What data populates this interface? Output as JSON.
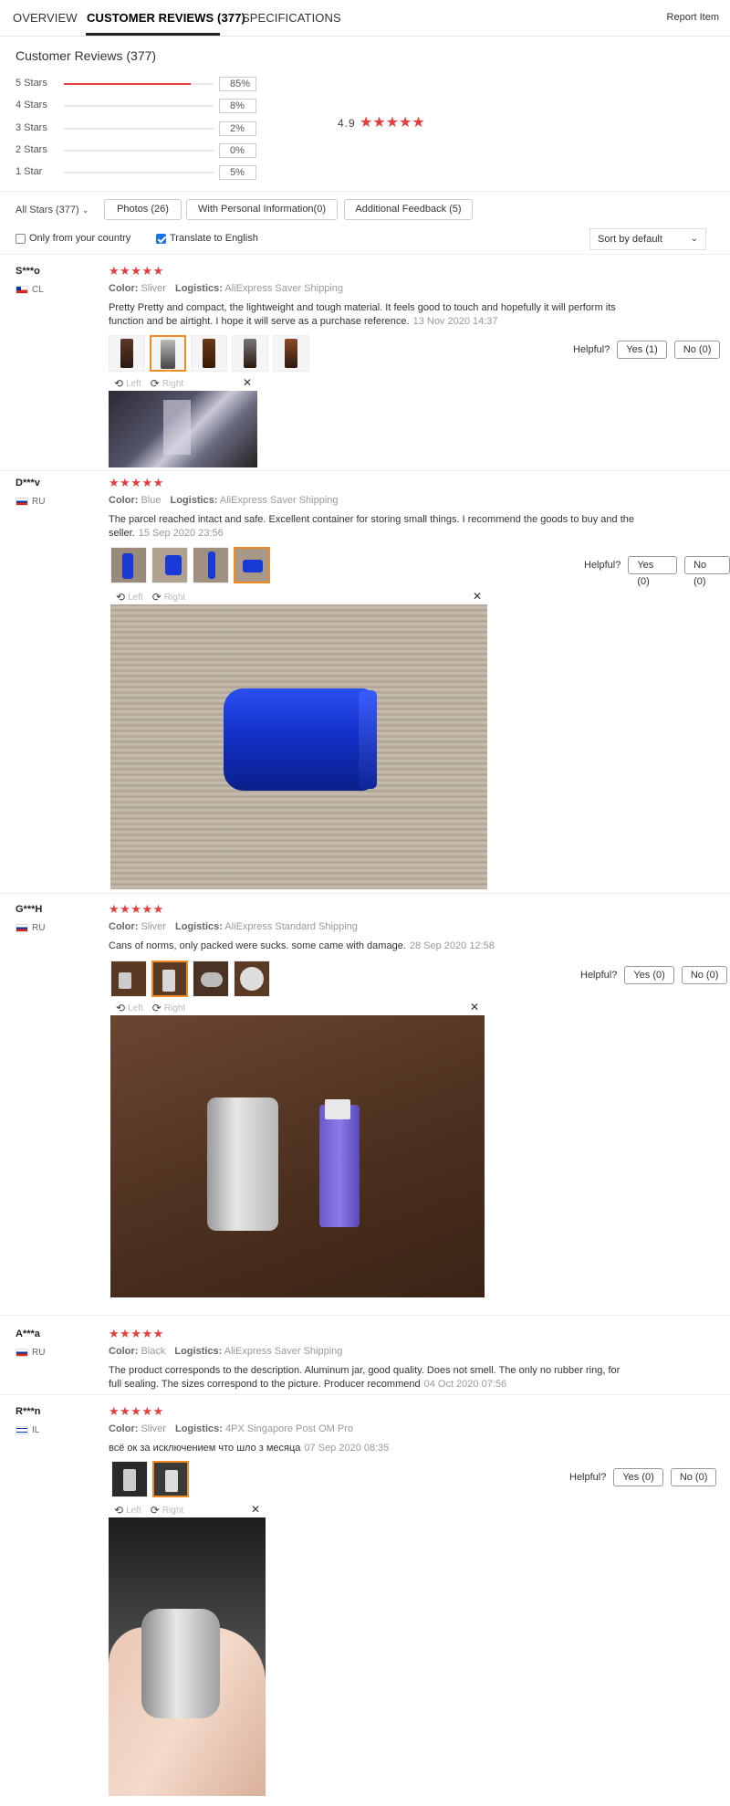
{
  "tabs": {
    "overview": "OVERVIEW",
    "reviews": "CUSTOMER REVIEWS (377)",
    "specs": "SPECIFICATIONS",
    "report": "Report Item"
  },
  "summary": {
    "title": "Customer Reviews (377)",
    "distribution": [
      {
        "label": "5 Stars",
        "pct": "85%",
        "fraction": 0.85
      },
      {
        "label": "4 Stars",
        "pct": "8%",
        "fraction": 0.08
      },
      {
        "label": "3 Stars",
        "pct": "2%",
        "fraction": 0.02
      },
      {
        "label": "2 Stars",
        "pct": "0%",
        "fraction": 0.0
      },
      {
        "label": "1 Star",
        "pct": "5%",
        "fraction": 0.05
      }
    ],
    "average": "4.9",
    "average_stars": "★★★★★"
  },
  "filters": {
    "all_stars": "All Stars (377)",
    "photos": "Photos (26)",
    "personal": "With Personal Information(0)",
    "additional": "Additional Feedback (5)",
    "only_country": "Only from your country",
    "translate": "Translate to English",
    "sort": "Sort by default"
  },
  "viewer": {
    "left": "Left",
    "right": "Right"
  },
  "helpful_label": "Helpful?",
  "reviews": [
    {
      "user": "S***o",
      "country": "CL",
      "stars": "★★★★★",
      "color_label": "Color:",
      "color": "Sliver",
      "logistics_label": "Logistics:",
      "logistics": "AliExpress Saver Shipping",
      "text_line1": "Pretty Pretty and compact, the lightweight and tough material. It feels good to touch and hopefully it will perform its",
      "text_line2": "function and be airtight. I hope it will serve as a purchase reference.",
      "date": "13 Nov 2020 14:37",
      "yes": "Yes (1)",
      "no": "No (0)"
    },
    {
      "user": "D***v",
      "country": "RU",
      "stars": "★★★★★",
      "color_label": "Color:",
      "color": "Blue",
      "logistics_label": "Logistics:",
      "logistics": "AliExpress Saver Shipping",
      "text_line1": "The parcel reached intact and safe. Excellent container for storing small things. I recommend the goods to buy and the",
      "text_line2": "seller.",
      "date": "15 Sep 2020 23:56",
      "yes": "Yes (0)",
      "no": "No (0)"
    },
    {
      "user": "G***H",
      "country": "RU",
      "stars": "★★★★★",
      "color_label": "Color:",
      "color": "Sliver",
      "logistics_label": "Logistics:",
      "logistics": "AliExpress Standard Shipping",
      "text_line1": "Cans of norms, only packed were sucks. some came with damage.",
      "date": "28 Sep 2020 12:58",
      "yes": "Yes (0)",
      "no": "No (0)"
    },
    {
      "user": "A***a",
      "country": "RU",
      "stars": "★★★★★",
      "color_label": "Color:",
      "color": "Black",
      "logistics_label": "Logistics:",
      "logistics": "AliExpress Saver Shipping",
      "text_line1": "The product corresponds to the description. Aluminum jar, good quality. Does not smell. The only no rubber ring, for",
      "text_line2": "full sealing. The sizes correspond to the picture. Producer recommend",
      "date": "04 Oct 2020 07:56"
    },
    {
      "user": "R***n",
      "country": "IL",
      "stars": "★★★★★",
      "color_label": "Color:",
      "color": "Sliver",
      "logistics_label": "Logistics:",
      "logistics": "4PX Singapore Post OM Pro",
      "text_line1": "всё ок за исключением что шло з месяца",
      "date": "07 Sep 2020 08:35",
      "yes": "Yes (0)",
      "no": "No (0)"
    }
  ]
}
